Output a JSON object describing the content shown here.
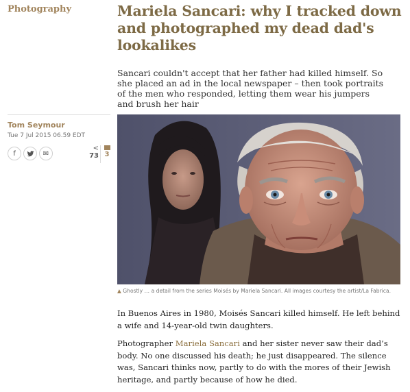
{
  "section": "Photography",
  "article": {
    "headline": "Mariela Sancari: why I tracked down and photographed my dead dad's lookalikes",
    "standfirst": "Sancari couldn't accept that her father had killed himself. So she placed an ad in the local newspaper – then took portraits of the men who responded, letting them wear his jumpers and brush her hair",
    "byline": "Tom Seymour",
    "date": "Tue 7 Jul 2015 06.59 EDT",
    "share_count": "73",
    "comment_count": "3",
    "caption": "Ghostly … a detail from the series Moisés by Mariela Sancari. All images courtesy the artist/La Fabrica.",
    "paragraph1": "In Buenos Aires in 1980, Moisés Sancari killed himself. He left behind a wife and 14-year-old twin daughters.",
    "paragraph2": {
      "before": "Photographer ",
      "link": "Mariela Sancari",
      "after": " and her sister never saw their dad’s body. No one discussed his death; he just disappeared. The silence was, Sancari thinks now, partly to do with the mores of their Jewish heritage, and partly because of how he died."
    }
  },
  "share_buttons": [
    {
      "icon": "facebook-icon",
      "glyph": "f"
    },
    {
      "icon": "twitter-icon",
      "glyph": "🐦"
    },
    {
      "icon": "email-icon",
      "glyph": "✉"
    }
  ],
  "colors": {
    "accent": "#a1845c",
    "headline": "#7d6a45"
  }
}
